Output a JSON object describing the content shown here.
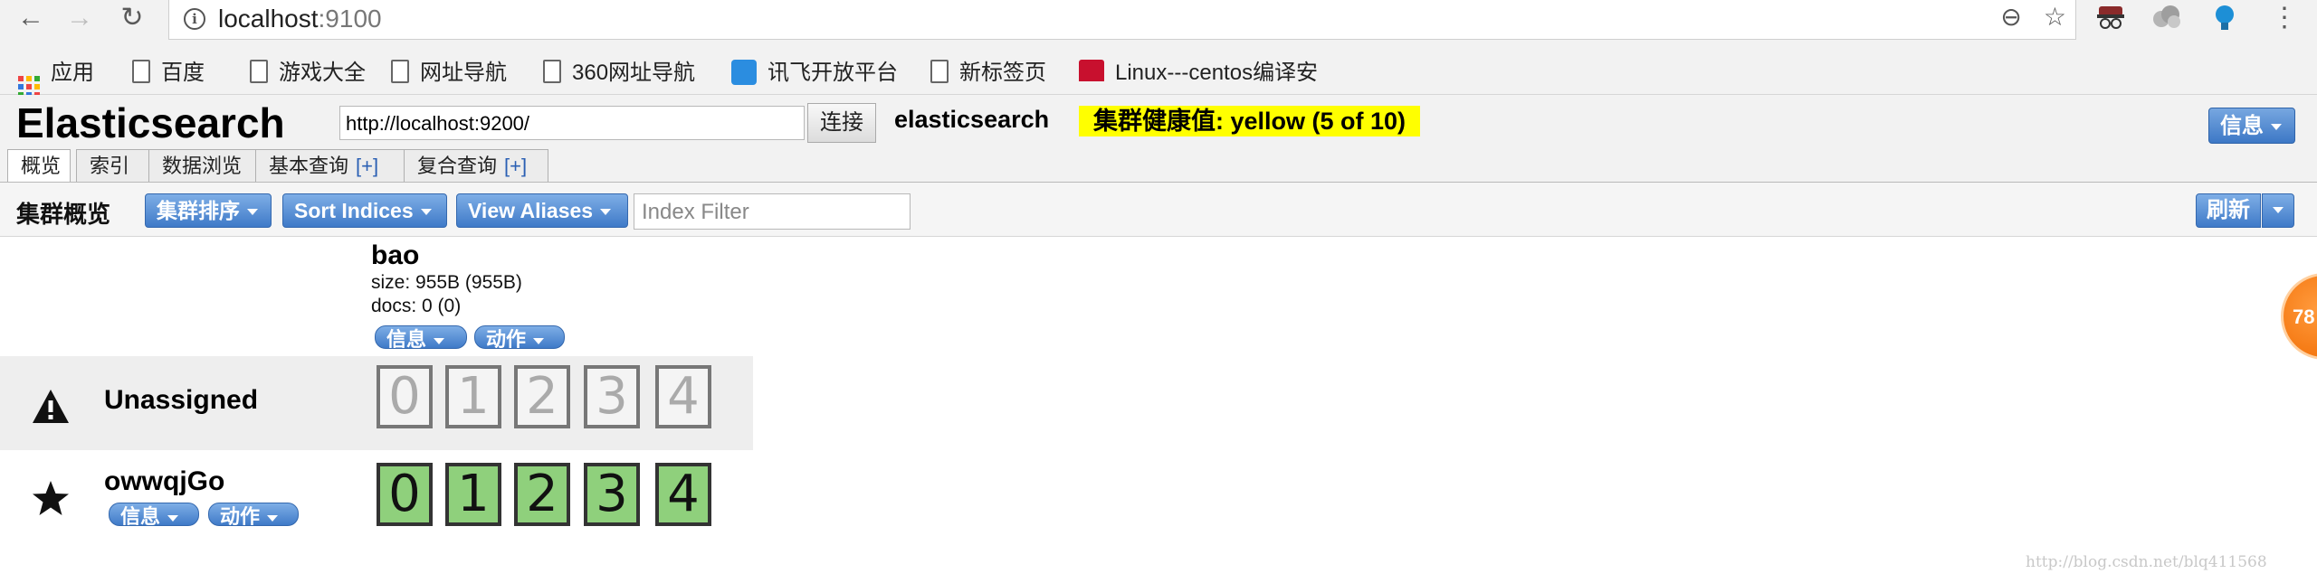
{
  "browser": {
    "url_host": "localhost",
    "url_port": ":9100",
    "back_glyph": "←",
    "forward_glyph": "→",
    "reload_glyph": "↻",
    "zoom_glyph": "⊖",
    "star_glyph": "☆",
    "menu_glyph": "⋮",
    "info_glyph": "i",
    "extensions": [
      "incognito-mask-icon",
      "cloud-icon",
      "bulb-icon"
    ]
  },
  "bookmarks": [
    {
      "label": "应用",
      "icon": "apps-icon"
    },
    {
      "label": "百度",
      "icon": "page-icon"
    },
    {
      "label": "游戏大全",
      "icon": "page-icon"
    },
    {
      "label": "网址导航",
      "icon": "page-icon"
    },
    {
      "label": "360网址导航",
      "icon": "page-icon"
    },
    {
      "label": "讯飞开放平台",
      "icon": "xunfei-icon"
    },
    {
      "label": "新标签页",
      "icon": "page-icon"
    },
    {
      "label": "Linux---centos编译安",
      "icon": "csdn-icon"
    }
  ],
  "header": {
    "brand": "Elasticsearch",
    "cluster_uri": "http://localhost:9200/",
    "connect_label": "连接",
    "cluster_name": "elasticsearch",
    "health_text": "集群健康值: yellow (5 of 10)",
    "info_label": "信息",
    "health_color": "#ffff00"
  },
  "tabs": [
    {
      "label": "概览",
      "plus": ""
    },
    {
      "label": "索引",
      "plus": ""
    },
    {
      "label": "数据浏览",
      "plus": ""
    },
    {
      "label": "基本查询",
      "plus": "[+]"
    },
    {
      "label": "复合查询",
      "plus": "[+]"
    }
  ],
  "toolbar": {
    "title": "集群概览",
    "sort_cluster_label": "集群排序",
    "sort_indices_label": "Sort Indices",
    "view_aliases_label": "View Aliases",
    "filter_placeholder": "Index Filter",
    "refresh_label": "刷新"
  },
  "index": {
    "name": "bao",
    "size": "size: 955B (955B)",
    "docs": "docs: 0 (0)",
    "info_label": "信息",
    "action_label": "动作"
  },
  "rows": {
    "unassigned": {
      "label": "Unassigned",
      "icon": "warning-icon",
      "shards": [
        "0",
        "1",
        "2",
        "3",
        "4"
      ]
    },
    "node": {
      "label": "owwqjGo",
      "icon": "star-icon",
      "info_label": "信息",
      "action_label": "动作",
      "shards": [
        "0",
        "1",
        "2",
        "3",
        "4"
      ]
    }
  },
  "floating_badge": "78",
  "watermark": "http://blog.csdn.net/blq411568"
}
